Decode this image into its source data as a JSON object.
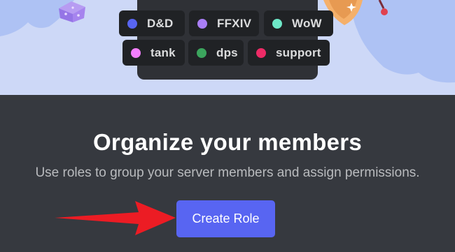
{
  "roles_preview": [
    {
      "label": "D&D",
      "color": "#5865f2"
    },
    {
      "label": "FFXIV",
      "color": "#a97ef5"
    },
    {
      "label": "WoW",
      "color": "#6ee8c8"
    },
    {
      "label": "tank",
      "color": "#f47fff"
    },
    {
      "label": "dps",
      "color": "#3ba55d"
    },
    {
      "label": "support",
      "color": "#ed2b66"
    }
  ],
  "main": {
    "title": "Organize your members",
    "subtitle": "Use roles to group your server members and assign permissions.",
    "create_role_label": "Create Role"
  },
  "colors": {
    "accent": "#5865f2",
    "background": "#36393f",
    "hero_background": "#cdd8f7",
    "annotation_arrow": "#ec1c24"
  }
}
